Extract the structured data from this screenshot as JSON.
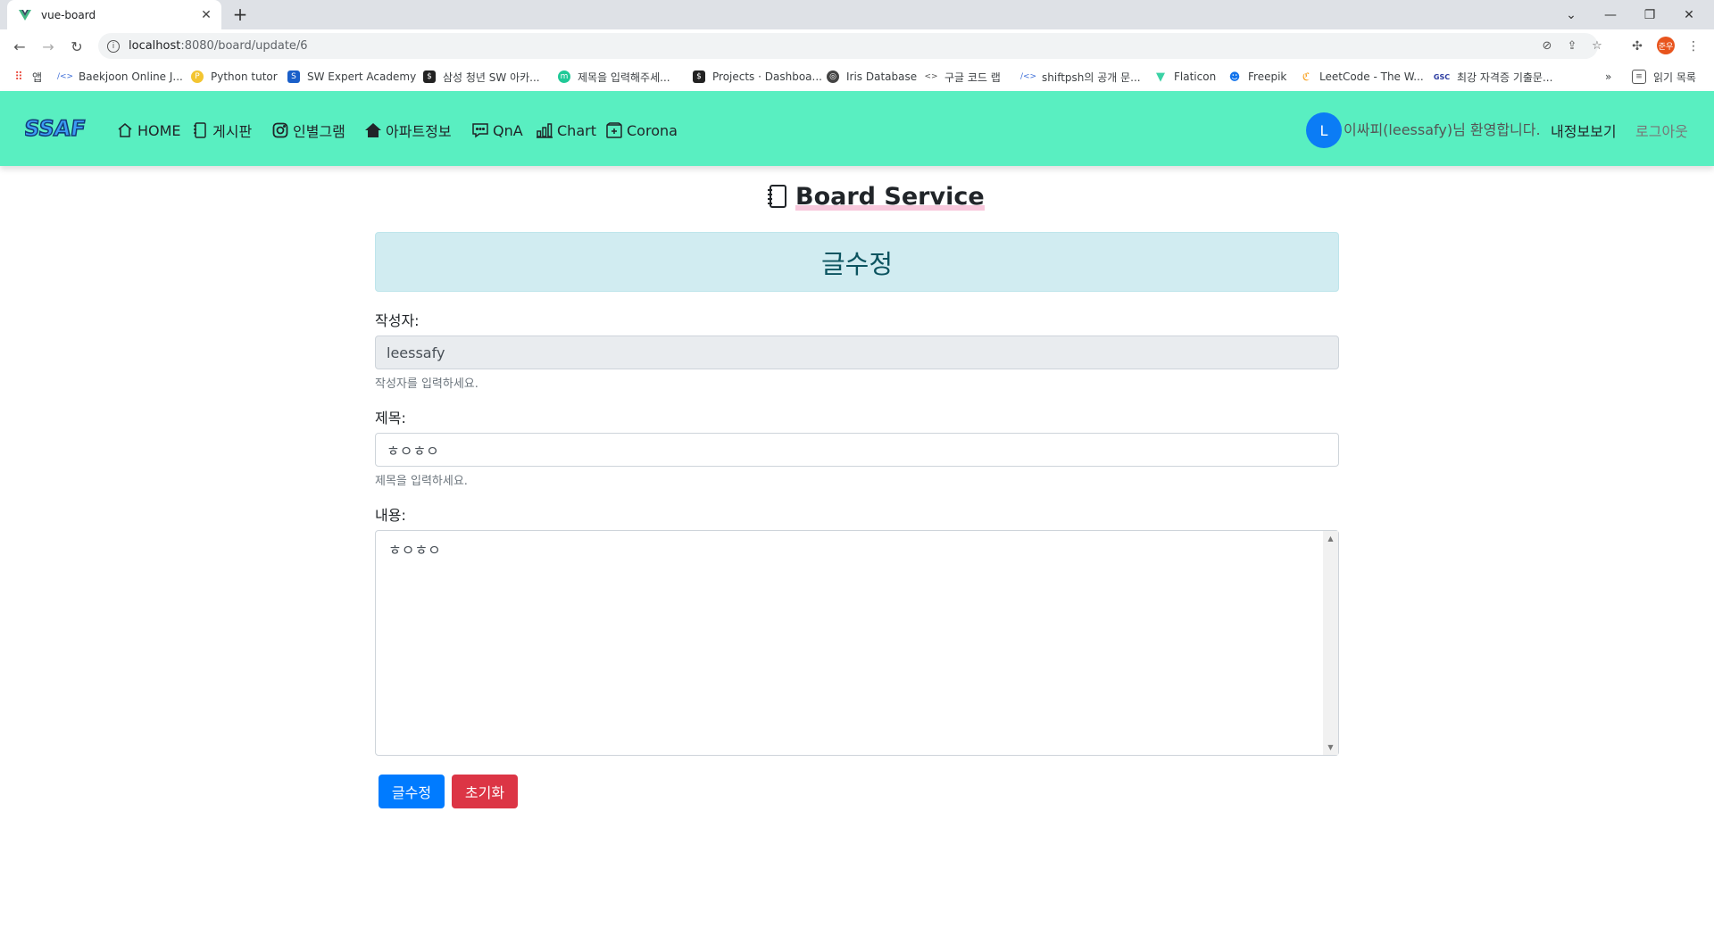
{
  "browser": {
    "tab_title": "vue-board",
    "url_host": "localhost",
    "url_path": ":8080/board/update/6",
    "bookmarks": [
      {
        "label": "앱",
        "color": "#e94235"
      },
      {
        "label": "Baekjoon Online J...",
        "color": "#3f6fd8"
      },
      {
        "label": "Python tutor",
        "color": "#f3c531"
      },
      {
        "label": "SW Expert Academy",
        "color": "#1a5fc9"
      },
      {
        "label": "삼성 청년 SW 아카...",
        "color": "#222222"
      },
      {
        "label": "제목을 입력해주세...",
        "color": "#20c997"
      },
      {
        "label": "Projects · Dashboa...",
        "color": "#222222"
      },
      {
        "label": "Iris Database",
        "color": "#444444"
      },
      {
        "label": "구글 코드 랩",
        "color": "#555555"
      },
      {
        "label": "shiftpsh의 공개 문...",
        "color": "#3f6fd8"
      },
      {
        "label": "Flaticon",
        "color": "#3bd2a5"
      },
      {
        "label": "Freepik",
        "color": "#1273eb"
      },
      {
        "label": "LeetCode - The W...",
        "color": "#f89f1b"
      },
      {
        "label": "최강 자격증 기출문...",
        "color": "#2a3aa0"
      },
      {
        "label": "읽기 목록",
        "color": "#555555"
      }
    ],
    "profile_initial": "준우"
  },
  "navbar": {
    "items": [
      {
        "label": "HOME",
        "icon": "house-icon"
      },
      {
        "label": "게시판",
        "icon": "notebook-icon"
      },
      {
        "label": "인별그램",
        "icon": "instagram-icon"
      },
      {
        "label": "아파트정보",
        "icon": "house-fill-icon"
      },
      {
        "label": "QnA",
        "icon": "chat-icon"
      },
      {
        "label": "Chart",
        "icon": "bar-chart-icon"
      },
      {
        "label": "Corona",
        "icon": "plus-square-icon"
      }
    ],
    "avatar_initial": "L",
    "welcome": "이싸피(leessafy)님 환영합니다.",
    "mypage": "내정보보기",
    "logout": "로그아웃",
    "bg_color": "#59efc1"
  },
  "main": {
    "heading": "Board Service",
    "alert_title": "글수정",
    "writer_label": "작성자:",
    "writer_value": "leessafy",
    "writer_help": "작성자를 입력하세요.",
    "subject_label": "제목:",
    "subject_value": "ㅎㅇㅎㅇ",
    "subject_help": "제목을 입력하세요.",
    "content_label": "내용:",
    "content_value": "ㅎㅇㅎㅇ",
    "submit_label": "글수정",
    "reset_label": "초기화"
  }
}
